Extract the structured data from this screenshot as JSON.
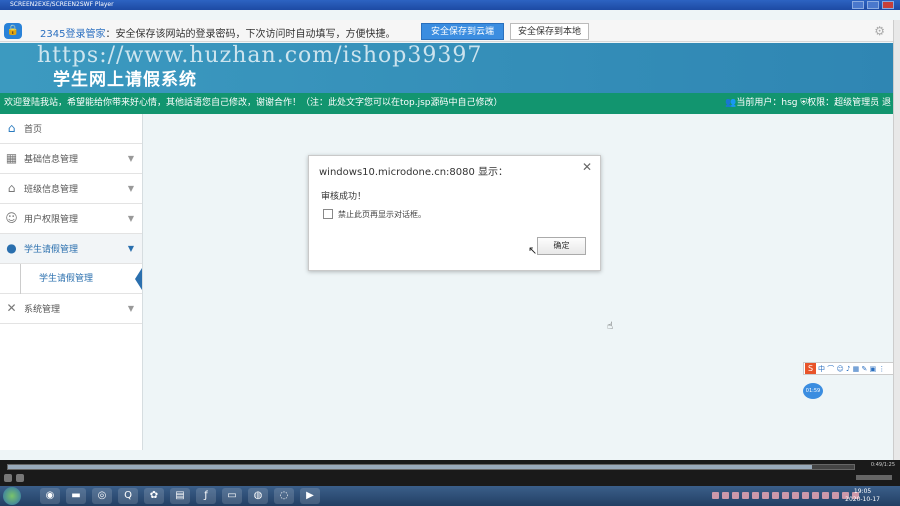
{
  "player": {
    "title": "SCREEN2EXE/SCREEN2SWF Player"
  },
  "password_bar": {
    "brand": "2345登录管家",
    "message": "：安全保存该网站的登录密码，下次访问时自动填写，方便快捷。",
    "save_cloud": "安全保存到云端",
    "save_local": "安全保存到本地"
  },
  "header": {
    "watermark": "https://www.huzhan.com/ishop39397",
    "title": "学生网上请假系统"
  },
  "infobar": {
    "welcome": "欢迎登陆我站，希望能给你带来好心情，其他話语您自己修改，谢谢合作！（注：此处文字您可以在top.jsp源码中自己修改）",
    "current_user": "当前用户：hsg",
    "role": "权限：超级管理员 退"
  },
  "sidebar": {
    "items": [
      {
        "label": "首页",
        "icon": "home-icon"
      },
      {
        "label": "基础信息管理",
        "icon": "grid-icon"
      },
      {
        "label": "班级信息管理",
        "icon": "house-icon"
      },
      {
        "label": "用户权限管理",
        "icon": "user-icon"
      },
      {
        "label": "学生请假管理",
        "icon": "user-icon"
      },
      {
        "label": "系统管理",
        "icon": "tools-icon"
      }
    ],
    "sub_item": "学生请假管理"
  },
  "dialog": {
    "title": "windows10.microdone.cn:8080 显示：",
    "message": "审核成功！",
    "checkbox_label": "禁止此页再显示对话框。",
    "ok_label": "确定"
  },
  "ime": {
    "time": "01:59"
  },
  "player_bar": {
    "time": "0:49/1:25",
    "progress": 0.95
  },
  "taskbar": {
    "time": "19:05",
    "date": "2020-10-17"
  }
}
